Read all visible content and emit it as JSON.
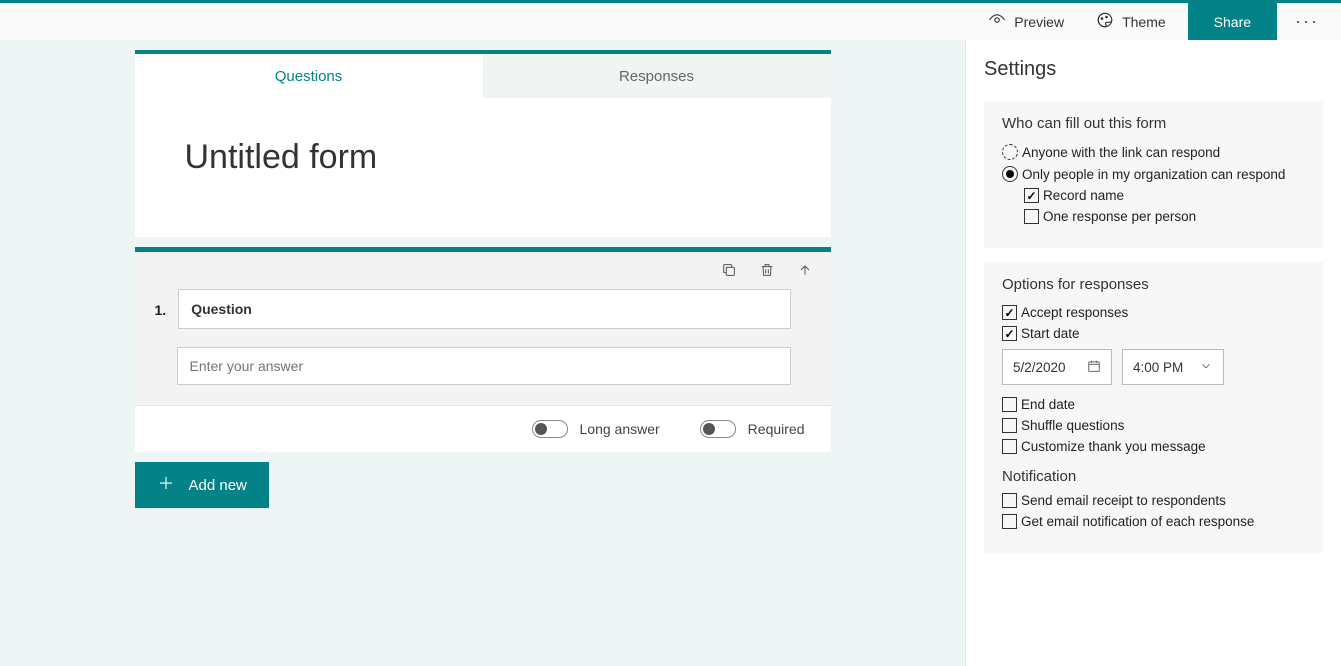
{
  "topbar": {
    "preview": "Preview",
    "theme": "Theme",
    "share": "Share"
  },
  "tabs": {
    "questions": "Questions",
    "responses": "Responses"
  },
  "form": {
    "title": "Untitled form"
  },
  "question": {
    "number": "1.",
    "label": "Question",
    "answer_placeholder": "Enter your answer",
    "long_answer": "Long answer",
    "required": "Required"
  },
  "add_new": "Add new",
  "settings": {
    "heading": "Settings",
    "who": {
      "title": "Who can fill out this form",
      "anyone": "Anyone with the link can respond",
      "org": "Only people in my organization can respond",
      "record_name": "Record name",
      "one_response": "One response per person"
    },
    "options": {
      "title": "Options for responses",
      "accept": "Accept responses",
      "start": "Start date",
      "date": "5/2/2020",
      "time": "4:00 PM",
      "end": "End date",
      "shuffle": "Shuffle questions",
      "customize": "Customize thank you message"
    },
    "notif": {
      "title": "Notification",
      "receipt": "Send email receipt to respondents",
      "each": "Get email notification of each response"
    }
  }
}
